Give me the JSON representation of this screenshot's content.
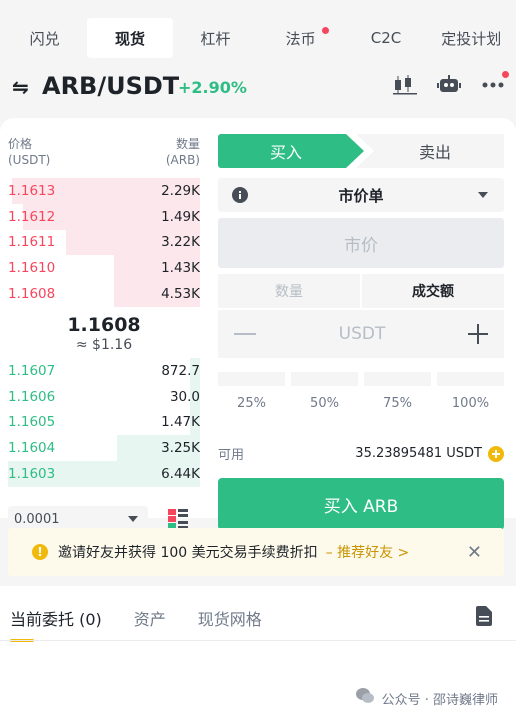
{
  "top_tabs": [
    {
      "label": "闪兑",
      "active": false,
      "dot": false
    },
    {
      "label": "现货",
      "active": true,
      "dot": false
    },
    {
      "label": "杠杆",
      "active": false,
      "dot": false
    },
    {
      "label": "法币",
      "active": false,
      "dot": true
    },
    {
      "label": "C2C",
      "active": false,
      "dot": false
    },
    {
      "label": "定投计划",
      "active": false,
      "dot": false
    }
  ],
  "header": {
    "pair": "ARB/USDT",
    "change": "+2.90%",
    "icons": [
      "candlestick-chart-icon",
      "robot-icon",
      "more-icon"
    ]
  },
  "orderbook": {
    "price_header": "价格",
    "price_unit": "(USDT)",
    "qty_header": "数量",
    "qty_unit": "(ARB)",
    "asks": [
      {
        "price": "1.1613",
        "qty": "2.29K",
        "depth": 0.98
      },
      {
        "price": "1.1612",
        "qty": "1.49K",
        "depth": 0.92
      },
      {
        "price": "1.1611",
        "qty": "3.22K",
        "depth": 0.7
      },
      {
        "price": "1.1610",
        "qty": "1.43K",
        "depth": 0.45
      },
      {
        "price": "1.1608",
        "qty": "4.53K",
        "depth": 0.45
      }
    ],
    "mid_price": "1.1608",
    "mid_usd": "≈ $1.16",
    "bids": [
      {
        "price": "1.1607",
        "qty": "872.7",
        "depth": 0.05
      },
      {
        "price": "1.1606",
        "qty": "30.0",
        "depth": 0.05
      },
      {
        "price": "1.1605",
        "qty": "1.47K",
        "depth": 0.05
      },
      {
        "price": "1.1604",
        "qty": "3.25K",
        "depth": 0.43
      },
      {
        "price": "1.1603",
        "qty": "6.44K",
        "depth": 1.0
      }
    ],
    "tick_size": "0.0001"
  },
  "form": {
    "buy_label": "买入",
    "sell_label": "卖出",
    "order_type": "市价单",
    "price_placeholder": "市价",
    "amount_tab": "数量",
    "total_tab": "成交额",
    "unit": "USDT",
    "percents": [
      "25%",
      "50%",
      "75%",
      "100%"
    ],
    "available_label": "可用",
    "available_value": "35.23895481 USDT",
    "submit_label": "买入 ARB"
  },
  "promo": {
    "text": "邀请好友并获得 100 美元交易手续费折扣",
    "link": "– 推荐好友 >",
    "close": "✕"
  },
  "bottom_tabs": [
    {
      "label": "当前委托 (0)",
      "active": true
    },
    {
      "label": "资产",
      "active": false
    },
    {
      "label": "现货网格",
      "active": false
    }
  ],
  "watermark": "公众号 · 邵诗巍律师",
  "colors": {
    "buy": "#2ebd85",
    "sell": "#f6465d",
    "accent": "#f0b90b"
  }
}
